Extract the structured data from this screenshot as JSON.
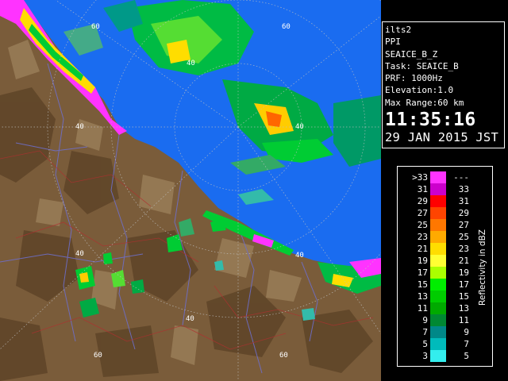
{
  "header": {
    "site": "ilts2",
    "mode": "PPI",
    "product": "SEAICE_B_Z",
    "task": "Task: SEAICE_B",
    "prf": "PRF: 1000Hz",
    "elevation": "Elevation:1.0",
    "max_range": "Max Range:60 km",
    "time": "11:35:16",
    "date": "29 JAN 2015 JST"
  },
  "range_labels": [
    "60",
    "60",
    "40",
    "40",
    "40",
    "40",
    "40",
    "60"
  ],
  "legend": {
    "title": "Reflectivity in dBZ",
    "rows": [
      {
        "lo": ">33",
        "hi": "---",
        "color": "#ff33ff"
      },
      {
        "lo": "31",
        "hi": "33",
        "color": "#cc00cc"
      },
      {
        "lo": "29",
        "hi": "31",
        "color": "#ff0000"
      },
      {
        "lo": "27",
        "hi": "29",
        "color": "#ff4400"
      },
      {
        "lo": "25",
        "hi": "27",
        "color": "#ff7700"
      },
      {
        "lo": "23",
        "hi": "25",
        "color": "#ffaa00"
      },
      {
        "lo": "21",
        "hi": "23",
        "color": "#ffdd00"
      },
      {
        "lo": "19",
        "hi": "21",
        "color": "#ffff33"
      },
      {
        "lo": "17",
        "hi": "19",
        "color": "#aaff00"
      },
      {
        "lo": "15",
        "hi": "17",
        "color": "#00ee00"
      },
      {
        "lo": "13",
        "hi": "15",
        "color": "#00cc00"
      },
      {
        "lo": "11",
        "hi": "13",
        "color": "#00aa00"
      },
      {
        "lo": "9",
        "hi": "11",
        "color": "#008833"
      },
      {
        "lo": "7",
        "hi": "9",
        "color": "#008888"
      },
      {
        "lo": "5",
        "hi": "7",
        "color": "#00bbbb"
      },
      {
        "lo": "3",
        "hi": "5",
        "color": "#33eeee"
      }
    ]
  },
  "colors": {
    "sea": "#1a6cf0",
    "land": "#7a5c3a",
    "range_ring": "#c0c0c0",
    "coast_echo": "#ff33ff"
  }
}
